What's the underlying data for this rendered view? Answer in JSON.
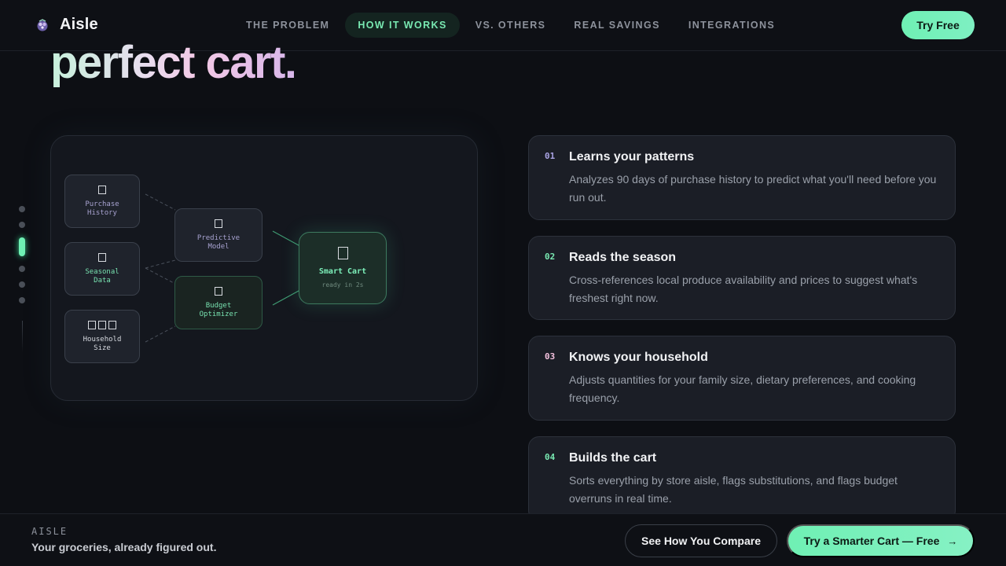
{
  "nav": {
    "brand": "Aisle",
    "links": [
      {
        "label": "THE PROBLEM",
        "active": false
      },
      {
        "label": "HOW IT WORKS",
        "active": true
      },
      {
        "label": "VS. OTHERS",
        "active": false
      },
      {
        "label": "REAL SAVINGS",
        "active": false
      },
      {
        "label": "INTEGRATIONS",
        "active": false
      }
    ],
    "cta": "Try Free"
  },
  "hero": {
    "headline_fragment": "perfect cart."
  },
  "section_dots": {
    "count": 6,
    "active_index": 2
  },
  "diagram": {
    "inputs": [
      {
        "line1": "Purchase",
        "line2": "History",
        "icon": "document-icon"
      },
      {
        "line1": "Seasonal",
        "line2": "Data",
        "icon": "calendar-icon"
      },
      {
        "line1": "Household",
        "line2": "Size",
        "icon": "people-icon"
      }
    ],
    "processors": [
      {
        "line1": "Predictive",
        "line2": "Model",
        "icon": "brain-icon"
      },
      {
        "line1": "Budget",
        "line2": "Optimizer",
        "icon": "coin-icon"
      }
    ],
    "output": {
      "title": "Smart Cart",
      "subtitle": "ready in 2s",
      "icon": "cart-icon"
    }
  },
  "steps": [
    {
      "num": "01",
      "title": "Learns your patterns",
      "desc": "Analyzes 90 days of purchase history to predict what you'll need before you run out.",
      "num_color": "#a9a3e3"
    },
    {
      "num": "02",
      "title": "Reads the season",
      "desc": "Cross-references local produce availability and prices to suggest what's freshest right now.",
      "num_color": "#79e9b2"
    },
    {
      "num": "03",
      "title": "Knows your household",
      "desc": "Adjusts quantities for your family size, dietary preferences, and cooking frequency.",
      "num_color": "#f3c0dd"
    },
    {
      "num": "04",
      "title": "Builds the cart",
      "desc": "Sorts everything by store aisle, flags substitutions, and flags budget overruns in real time.",
      "num_color": "#79e9b2"
    }
  ],
  "bottom_bar": {
    "brand": "AISLE",
    "tagline": "Your groceries, already figured out.",
    "secondary_cta": "See How You Compare",
    "primary_cta": "Try a Smarter Cart — Free",
    "primary_arrow": "→"
  },
  "colors": {
    "accent": "#6ff0b4",
    "background": "#0d0f14",
    "card": "#1b1e26"
  }
}
